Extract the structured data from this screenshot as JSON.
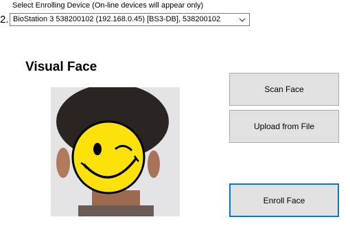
{
  "enroll_device": {
    "label": "Select Enrolling Device (On-line devices will appear only)",
    "step_number": "2.",
    "selected_value": "BioStation 3 538200102 (192.168.0.45)  [BS3-DB], 538200102"
  },
  "visual_face": {
    "title": "Visual Face"
  },
  "buttons": {
    "scan_face": "Scan Face",
    "upload_from_file": "Upload from File",
    "enroll_face": "Enroll Face"
  },
  "icons": {
    "dropdown": "chevron-down-icon",
    "face_overlay": "smiley-winking-icon"
  },
  "colors": {
    "focus_border": "#0078d7",
    "button_bg": "#e1e1e1",
    "smiley_yellow": "#fde10a"
  }
}
